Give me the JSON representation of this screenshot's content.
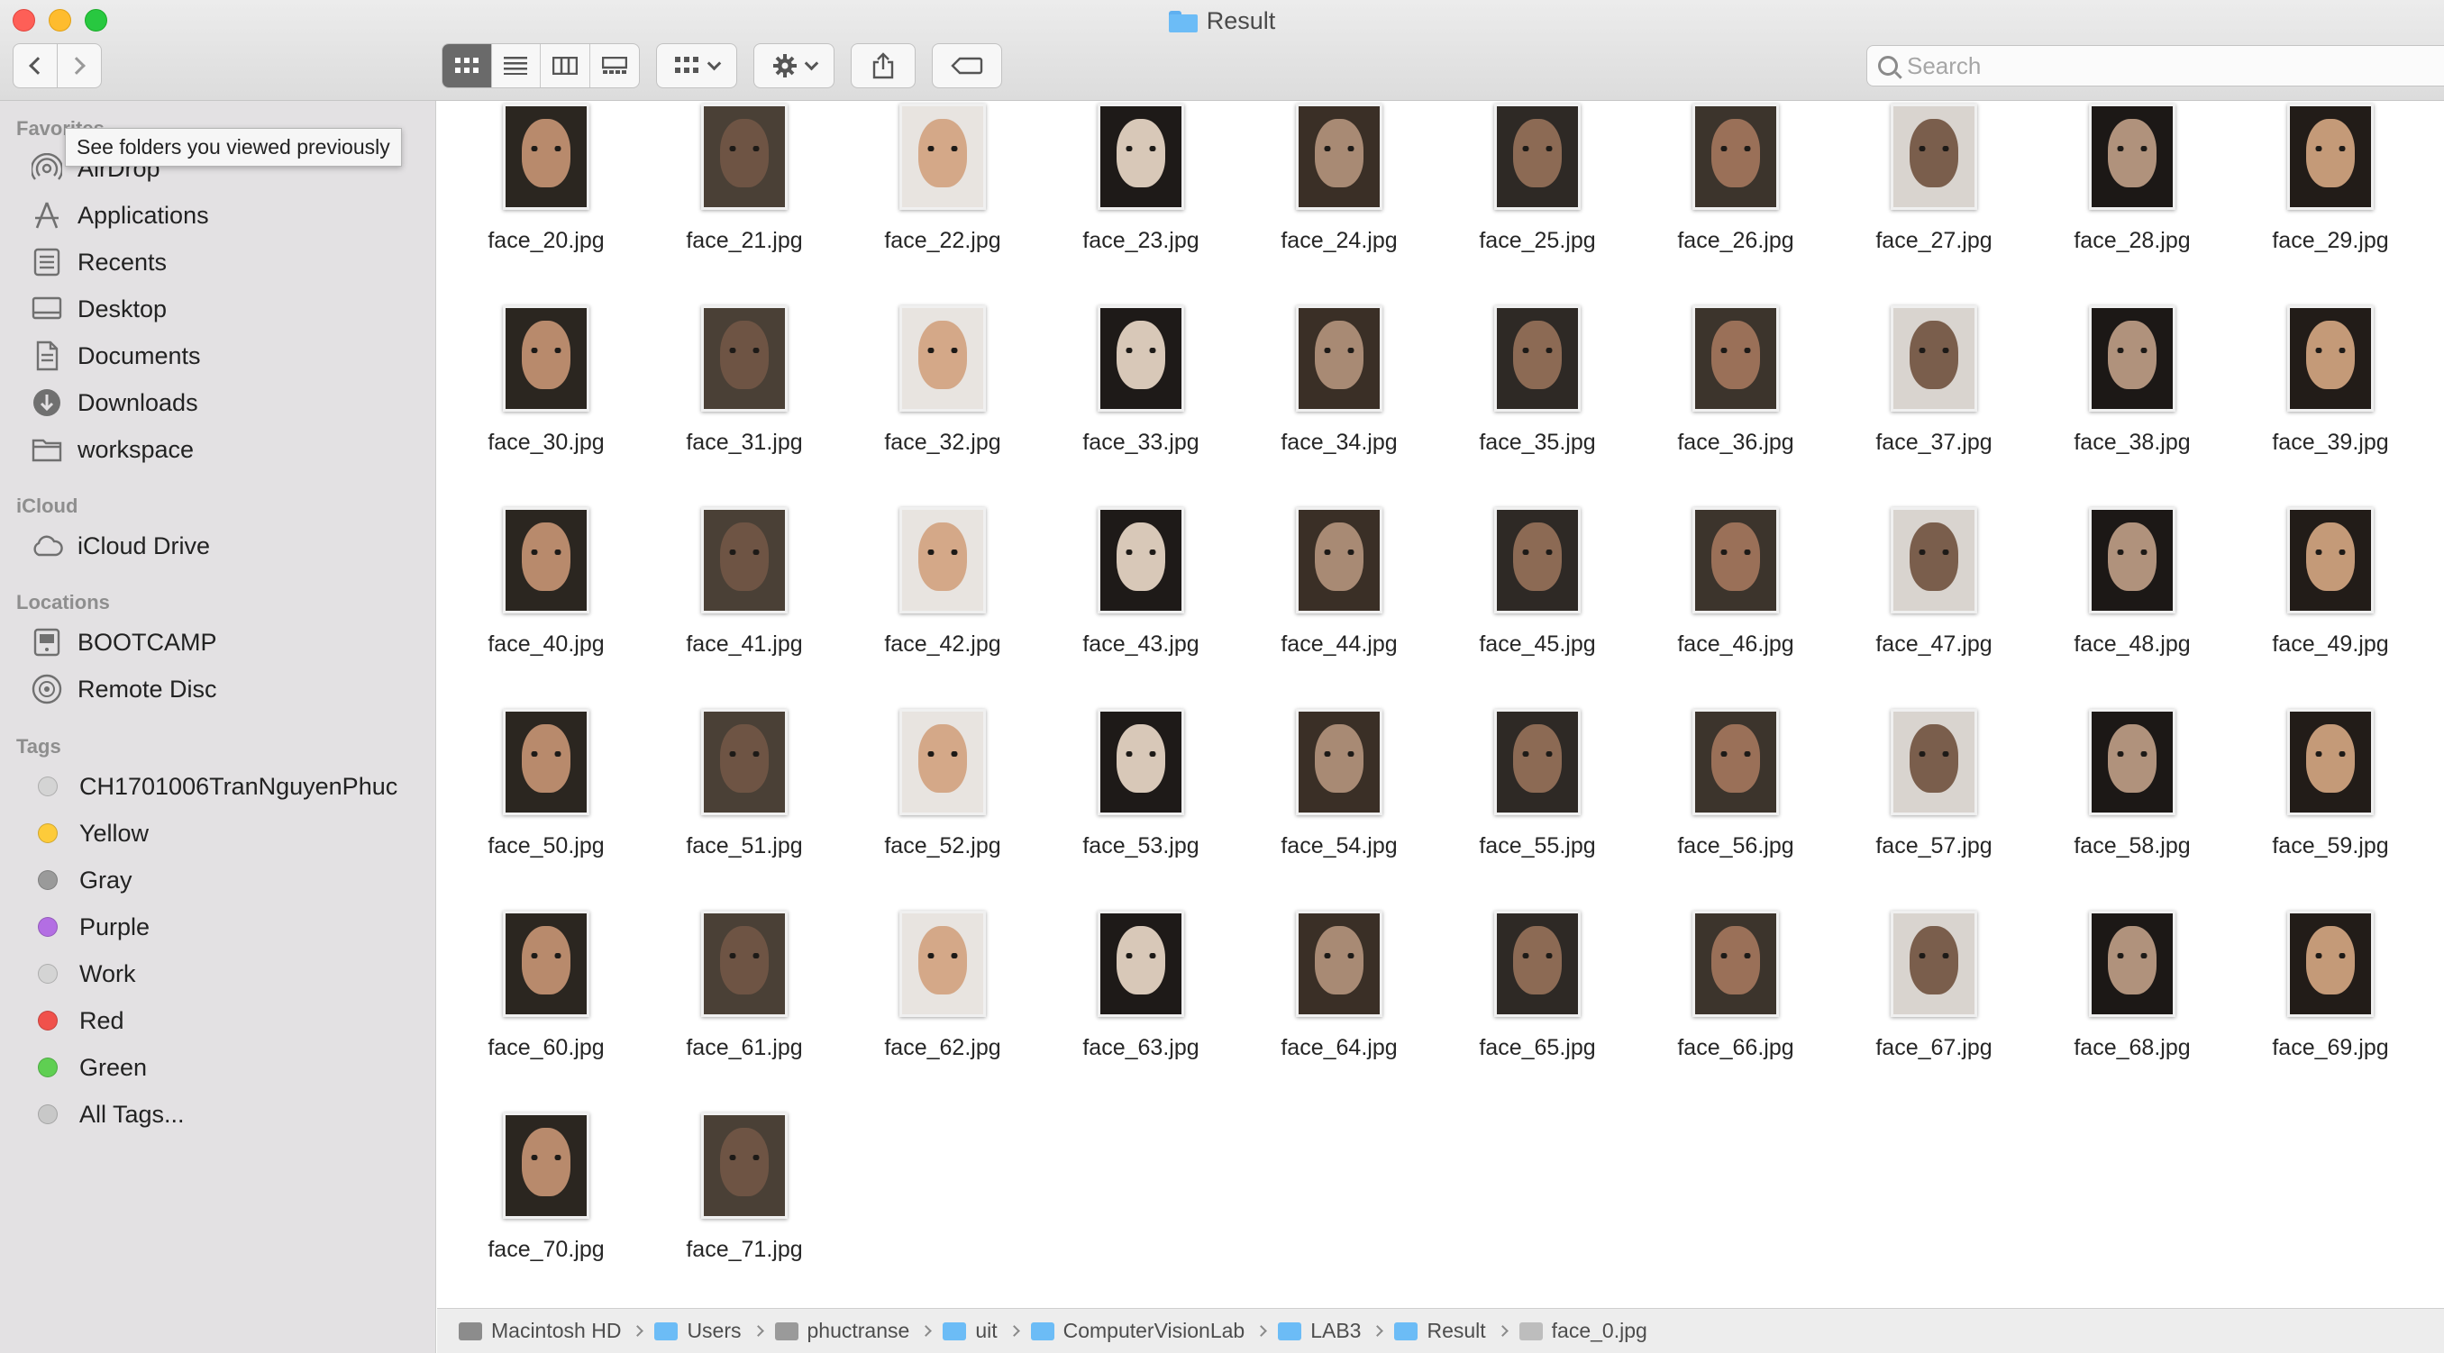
{
  "window": {
    "title": "Result"
  },
  "toolbar": {
    "back": "back-icon",
    "forward": "forward-icon",
    "views": [
      "icon-view-icon",
      "list-view-icon",
      "column-view-icon",
      "gallery-view-icon"
    ],
    "group": "group-icon",
    "action": "gear-icon",
    "share": "share-icon",
    "tag": "tag-icon"
  },
  "search": {
    "placeholder": "Search",
    "value": ""
  },
  "tooltip": "See folders you viewed previously",
  "sidebar": {
    "favorites_header": "Favorites",
    "favorites": [
      {
        "label": "AirDrop",
        "icon": "airdrop-icon"
      },
      {
        "label": "Applications",
        "icon": "applications-icon"
      },
      {
        "label": "Recents",
        "icon": "recents-icon"
      },
      {
        "label": "Desktop",
        "icon": "desktop-icon"
      },
      {
        "label": "Documents",
        "icon": "documents-icon"
      },
      {
        "label": "Downloads",
        "icon": "downloads-icon"
      },
      {
        "label": "workspace",
        "icon": "folder-icon"
      }
    ],
    "icloud_header": "iCloud",
    "icloud": [
      {
        "label": "iCloud Drive",
        "icon": "cloud-icon"
      }
    ],
    "locations_header": "Locations",
    "locations": [
      {
        "label": "BOOTCAMP",
        "icon": "drive-icon"
      },
      {
        "label": "Remote Disc",
        "icon": "disc-icon"
      }
    ],
    "tags_header": "Tags",
    "tags": [
      {
        "label": "CH1701006TranNguyenPhuc",
        "color": "#d4d4d4"
      },
      {
        "label": "Yellow",
        "color": "#fdcb3a"
      },
      {
        "label": "Gray",
        "color": "#9a9a9a"
      },
      {
        "label": "Purple",
        "color": "#b36ee3"
      },
      {
        "label": "Work",
        "color": "#d4d4d4"
      },
      {
        "label": "Red",
        "color": "#f0514b"
      },
      {
        "label": "Green",
        "color": "#5fcf52"
      },
      {
        "label": "All Tags...",
        "color": "#c8c8c8"
      }
    ]
  },
  "files": [
    "face_20.jpg",
    "face_21.jpg",
    "face_22.jpg",
    "face_23.jpg",
    "face_24.jpg",
    "face_25.jpg",
    "face_26.jpg",
    "face_27.jpg",
    "face_28.jpg",
    "face_29.jpg",
    "face_30.jpg",
    "face_31.jpg",
    "face_32.jpg",
    "face_33.jpg",
    "face_34.jpg",
    "face_35.jpg",
    "face_36.jpg",
    "face_37.jpg",
    "face_38.jpg",
    "face_39.jpg",
    "face_40.jpg",
    "face_41.jpg",
    "face_42.jpg",
    "face_43.jpg",
    "face_44.jpg",
    "face_45.jpg",
    "face_46.jpg",
    "face_47.jpg",
    "face_48.jpg",
    "face_49.jpg",
    "face_50.jpg",
    "face_51.jpg",
    "face_52.jpg",
    "face_53.jpg",
    "face_54.jpg",
    "face_55.jpg",
    "face_56.jpg",
    "face_57.jpg",
    "face_58.jpg",
    "face_59.jpg",
    "face_60.jpg",
    "face_61.jpg",
    "face_62.jpg",
    "face_63.jpg",
    "face_64.jpg",
    "face_65.jpg",
    "face_66.jpg",
    "face_67.jpg",
    "face_68.jpg",
    "face_69.jpg",
    "face_70.jpg",
    "face_71.jpg"
  ],
  "path": [
    {
      "label": "Macintosh HD",
      "icon": "drive-icon"
    },
    {
      "label": "Users",
      "icon": "folder-icon"
    },
    {
      "label": "phuctranse",
      "icon": "home-icon"
    },
    {
      "label": "uit",
      "icon": "folder-icon"
    },
    {
      "label": "ComputerVisionLab",
      "icon": "folder-icon"
    },
    {
      "label": "LAB3",
      "icon": "folder-icon"
    },
    {
      "label": "Result",
      "icon": "folder-icon"
    },
    {
      "label": "face_0.jpg",
      "icon": "image-file-icon"
    }
  ]
}
